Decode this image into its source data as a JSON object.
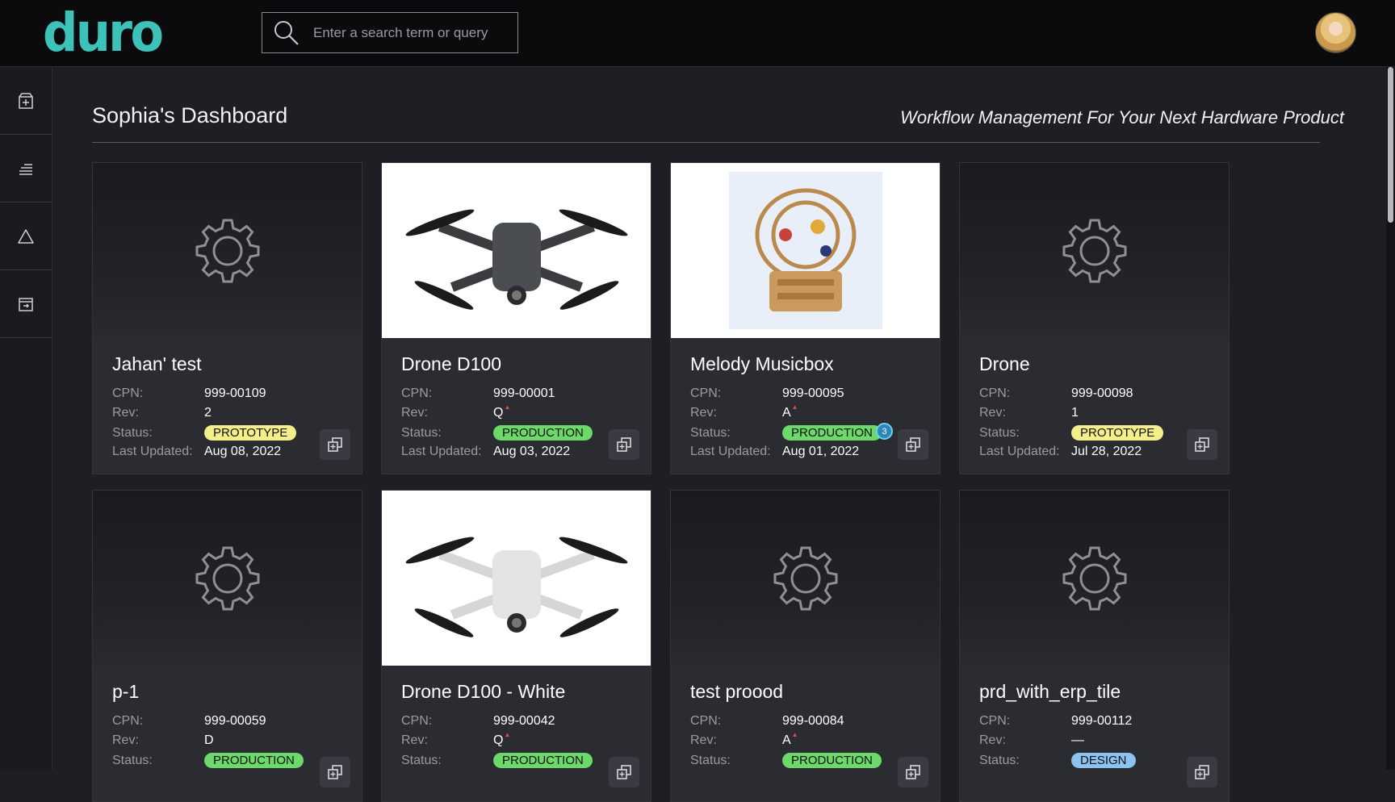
{
  "app": {
    "logo": "duro"
  },
  "search": {
    "placeholder": "Enter a search term or query"
  },
  "sidebar": {
    "items": [
      {
        "icon": "add-package-icon"
      },
      {
        "icon": "list-tree-icon"
      },
      {
        "icon": "change-order-triangle-icon"
      },
      {
        "icon": "export-box-icon"
      }
    ]
  },
  "header": {
    "title": "Sophia's Dashboard",
    "tagline": "Workflow Management For Your Next Hardware Product"
  },
  "labels": {
    "cpn": "CPN:",
    "rev": "Rev:",
    "status": "Status:",
    "last_updated": "Last Updated:"
  },
  "products": [
    {
      "name": "Jahan' test",
      "cpn": "999-00109",
      "rev": "2",
      "rev_modified": false,
      "status": "PROTOTYPE",
      "updated": "Aug 08, 2022",
      "image": "none"
    },
    {
      "name": "Drone D100",
      "cpn": "999-00001",
      "rev": "Q",
      "rev_modified": true,
      "status": "PRODUCTION",
      "updated": "Aug 03, 2022",
      "image": "drone-dark"
    },
    {
      "name": "Melody Musicbox",
      "cpn": "999-00095",
      "rev": "A",
      "rev_modified": true,
      "status": "PRODUCTION",
      "status_count": "3",
      "updated": "Aug 01, 2022",
      "image": "musicbox"
    },
    {
      "name": "Drone",
      "cpn": "999-00098",
      "rev": "1",
      "rev_modified": false,
      "status": "PROTOTYPE",
      "updated": "Jul 28, 2022",
      "image": "none"
    },
    {
      "name": "p-1",
      "cpn": "999-00059",
      "rev": "D",
      "rev_modified": false,
      "status": "PRODUCTION",
      "image": "none"
    },
    {
      "name": "Drone D100 - White",
      "cpn": "999-00042",
      "rev": "Q",
      "rev_modified": true,
      "status": "PRODUCTION",
      "image": "drone-white"
    },
    {
      "name": "test proood",
      "cpn": "999-00084",
      "rev": "A",
      "rev_modified": true,
      "status": "PRODUCTION",
      "image": "none"
    },
    {
      "name": "prd_with_erp_tile",
      "cpn": "999-00112",
      "rev": "—",
      "rev_modified": false,
      "status": "DESIGN",
      "image": "none"
    }
  ],
  "colors": {
    "brand": "#3cc2b8",
    "prototype": "#f3ef8a",
    "production": "#6dd96b",
    "design": "#8cc3f0"
  }
}
